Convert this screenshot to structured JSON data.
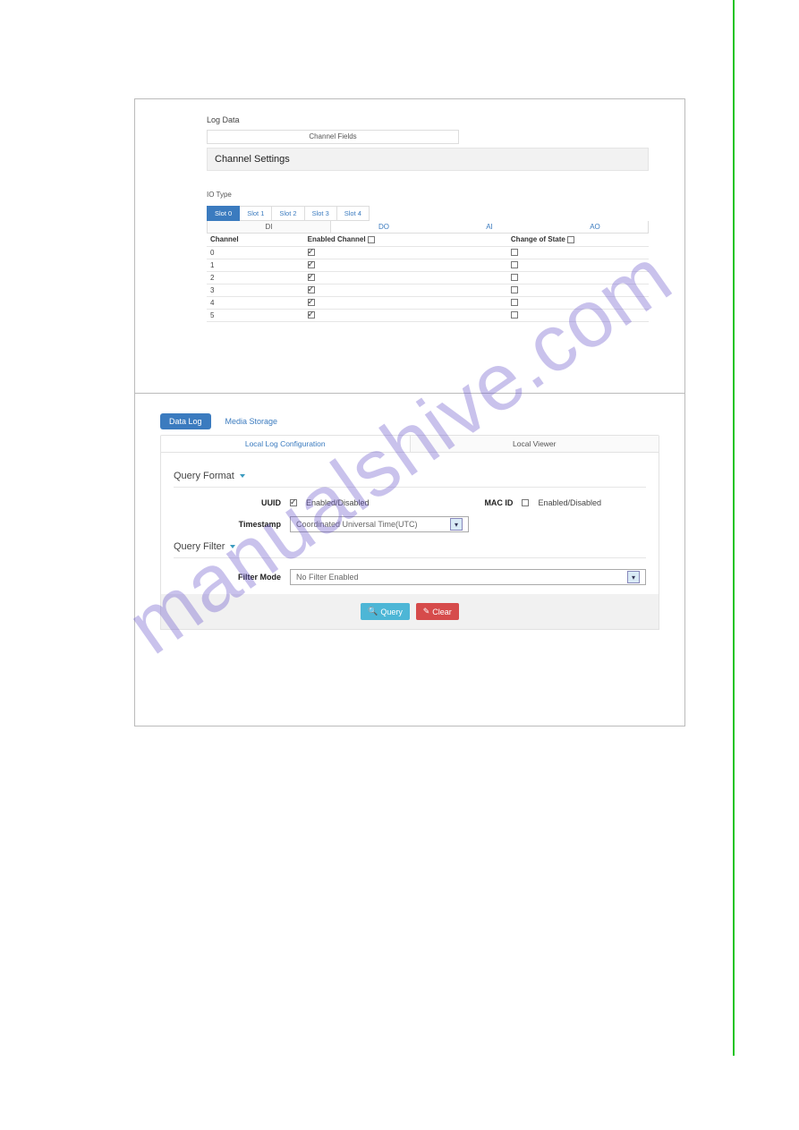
{
  "watermark": "manualshive.com",
  "upper": {
    "log_data": "Log Data",
    "channel_fields": "Channel Fields",
    "channel_settings": "Channel Settings",
    "io_type": "IO Type",
    "slot_tabs": [
      "Slot 0",
      "Slot 1",
      "Slot 2",
      "Slot 3",
      "Slot 4"
    ],
    "type_tabs": [
      "DI",
      "DO",
      "AI",
      "AO"
    ],
    "table": {
      "h_channel": "Channel",
      "h_enabled": "Enabled Channel",
      "h_cos": "Change of State",
      "rows": [
        {
          "ch": "0",
          "enabled": true,
          "cos": false
        },
        {
          "ch": "1",
          "enabled": true,
          "cos": false
        },
        {
          "ch": "2",
          "enabled": true,
          "cos": false
        },
        {
          "ch": "3",
          "enabled": true,
          "cos": false
        },
        {
          "ch": "4",
          "enabled": true,
          "cos": false
        },
        {
          "ch": "5",
          "enabled": true,
          "cos": false
        }
      ]
    }
  },
  "lower": {
    "tabs": {
      "data_log": "Data Log",
      "media_storage": "Media Storage"
    },
    "subtabs": {
      "local_log": "Local Log Configuration",
      "local_viewer": "Local Viewer"
    },
    "query_format": "Query Format",
    "query_filter": "Query Filter",
    "uuid_label": "UUID",
    "uuid_text": "Enabled/Disabled",
    "macid_label": "MAC ID",
    "macid_text": "Enabled/Disabled",
    "timestamp_label": "Timestamp",
    "timestamp_value": "Coordinated Universal Time(UTC)",
    "filter_mode_label": "Filter Mode",
    "filter_mode_value": "No Filter Enabled",
    "btn_query": "Query",
    "btn_clear": "Clear"
  }
}
